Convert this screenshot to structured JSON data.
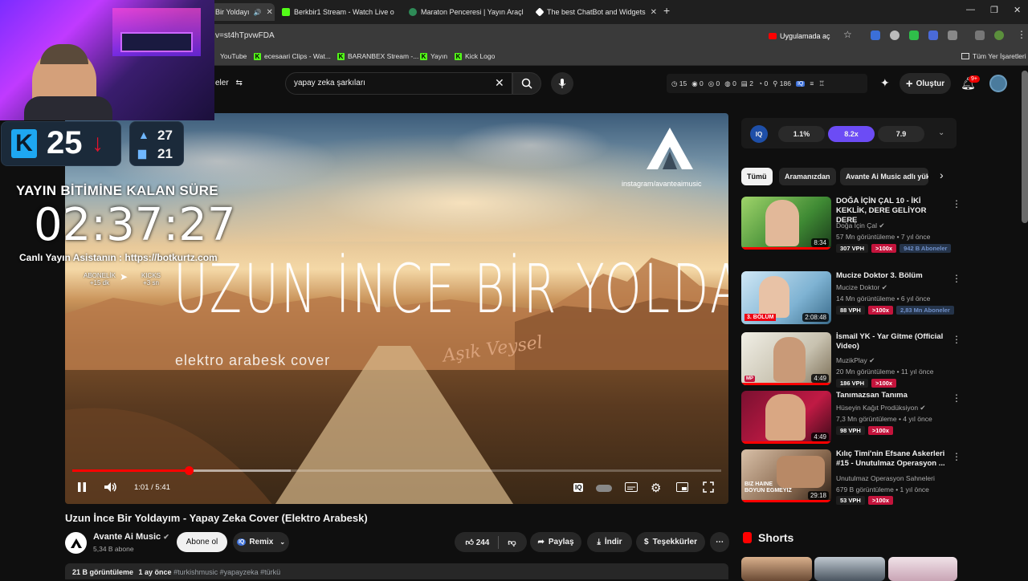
{
  "browser": {
    "tabs": [
      {
        "label": "Bir Yoldayı",
        "active": true
      },
      {
        "label": "Berkbir1 Stream - Watch Live o",
        "active": false
      },
      {
        "label": "Maraton Penceresi | Yayın Araçl",
        "active": false
      },
      {
        "label": "The best ChatBot and Widgets",
        "active": false
      }
    ],
    "url": "v=st4hTpvwFDA",
    "open_in_app": "Uygulamada aç",
    "bookmarks": [
      "YouTube",
      "ecesaari Clips - Wat...",
      "BARANBEX Stream -...",
      "Yayın",
      "Kick Logo"
    ],
    "all_bookmarks": "Tüm Yer İşaretleri"
  },
  "youtube_header": {
    "menu_label": "eler",
    "search_query": "yapay zeka şarkıları",
    "stats": [
      "15",
      "0",
      "0",
      "0",
      "2",
      "0",
      "186"
    ],
    "create_label": "Oluştur",
    "notif_badge": "9+"
  },
  "stream_overlay": {
    "kick_count": "25",
    "stat_top": "27",
    "stat_bottom": "21",
    "countdown_title": "YAYIN BİTİMİNE KALAN SÜRE",
    "countdown": "02:37:27",
    "assistant": "Canlı Yayın Asistanın : https://botkurtz.com",
    "abonelik_label": "ABONELİK",
    "abonelik_value": "+15 dk",
    "kicks_label": "KICKS",
    "kicks_value": "+3 sn"
  },
  "video": {
    "overlay_title": "UZUN İNCE BİR YOLDAYIM",
    "overlay_subtitle": "elektro arabesk cover",
    "overlay_signature": "Aşık Veysel",
    "brand": "AVANTE",
    "instagram": "instagram/avanteaimusic",
    "time": "1:01 / 5:41",
    "progress": 0.18
  },
  "details": {
    "title": "Uzun İnce Bir Yoldayım - Yapay Zeka Cover (Elektro Arabesk)",
    "channel": "Avante Ai Music",
    "subscribers": "5,34 B abone",
    "subscribe": "Abone ol",
    "remix": "Remix",
    "likes": "244",
    "share": "Paylaş",
    "download": "İndir",
    "thanks": "Teşekkürler",
    "views": "21 B görüntüleme",
    "ago": "1 ay önce",
    "tags": "#turkishmusic #yapayzeka #türkü"
  },
  "iq_panel": {
    "pills": [
      "1.1%",
      "8.2x",
      "7.9"
    ]
  },
  "chips": [
    "Tümü",
    "Aramanızdan",
    "Avante Ai Music adlı yük"
  ],
  "recommendations": [
    {
      "title": "DOĞA İÇİN ÇAL 10 - İKİ KEKLİK, DERE GELİYOR DERE",
      "channel": "Doğa İçin Çal",
      "meta": "57 Mn görüntüleme • 7 yıl önce",
      "duration": "8:34",
      "vph": "307 VPH",
      "pct": ">100x",
      "abo": "942 B Aboneler"
    },
    {
      "title": "Mucize Doktor 3. Bölüm",
      "channel": "Mucize Doktor",
      "meta": "14 Mn görüntüleme • 6 yıl önce",
      "duration": "2:08:48",
      "vph": "88 VPH",
      "pct": ">100x",
      "abo": "2,83 Mn Aboneler",
      "thumb_label": "3. BÖLÜM"
    },
    {
      "title": "İsmail YK - Yar Gitme (Official Video)",
      "channel": "MuzikPlay",
      "meta": "20 Mn görüntüleme • 11 yıl önce",
      "duration": "4:49",
      "vph": "186 VPH",
      "pct": ">100x",
      "abo": ""
    },
    {
      "title": "Tanımazsan Tanıma",
      "channel": "Hüseyin Kağıt Prodüksiyon",
      "meta": "7,3 Mn görüntüleme • 4 yıl önce",
      "duration": "4:49",
      "vph": "98 VPH",
      "pct": ">100x",
      "abo": ""
    },
    {
      "title": "Kılıç Timi'nin Efsane Askerleri #15 - Unutulmaz Operasyon ...",
      "channel": "Unutulmaz Operasyon Sahneleri",
      "meta": "679 B görüntüleme • 1 yıl önce",
      "duration": "29:18",
      "vph": "53 VPH",
      "pct": ">100x",
      "abo": "",
      "thumb_label": "BIZ HAINE BOYUN EGMEYIZ"
    }
  ],
  "shorts_label": "Shorts",
  "colors": {
    "youtube_red": "#ff0000",
    "kick_green": "#53fc18",
    "iq_purple": "#6c4cf5"
  }
}
